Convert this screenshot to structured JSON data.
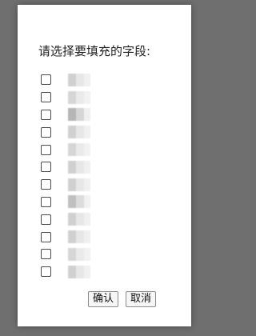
{
  "dialog": {
    "prompt": "请选择要填充的字段:",
    "fields": [
      {
        "checked": false
      },
      {
        "checked": false
      },
      {
        "checked": false
      },
      {
        "checked": false
      },
      {
        "checked": false
      },
      {
        "checked": false
      },
      {
        "checked": false
      },
      {
        "checked": false
      },
      {
        "checked": false
      },
      {
        "checked": false
      },
      {
        "checked": false
      },
      {
        "checked": false
      }
    ],
    "buttons": {
      "confirm": "确认",
      "cancel": "取消"
    }
  }
}
